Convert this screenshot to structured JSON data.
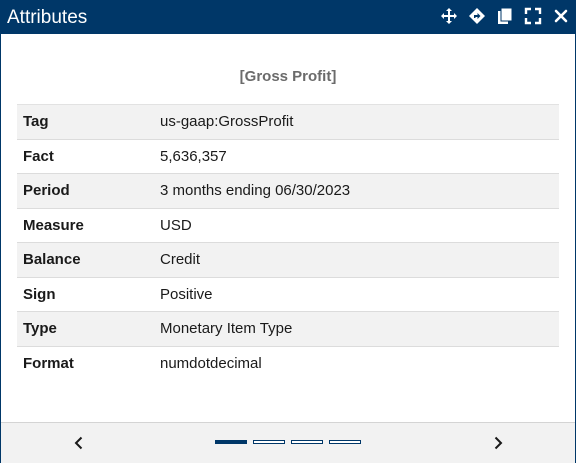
{
  "window": {
    "title": "Attributes"
  },
  "titlebar_icons": [
    "move-icon",
    "diamond-arrow-icon",
    "copy-icon",
    "expand-icon",
    "close-icon"
  ],
  "heading": "[Gross Profit]",
  "attributes": [
    {
      "key": "Tag",
      "value": "us-gaap:GrossProfit"
    },
    {
      "key": "Fact",
      "value": "5,636,357"
    },
    {
      "key": "Period",
      "value": "3 months ending 06/30/2023"
    },
    {
      "key": "Measure",
      "value": "USD"
    },
    {
      "key": "Balance",
      "value": "Credit"
    },
    {
      "key": "Sign",
      "value": "Positive"
    },
    {
      "key": "Type",
      "value": "Monetary Item Type"
    },
    {
      "key": "Format",
      "value": "numdotdecimal"
    }
  ],
  "pager": {
    "pages": 4,
    "active_index": 0
  },
  "colors": {
    "titlebar": "#003768",
    "row_alt": "#f2f2f2",
    "heading_text": "#6b6b6b"
  }
}
